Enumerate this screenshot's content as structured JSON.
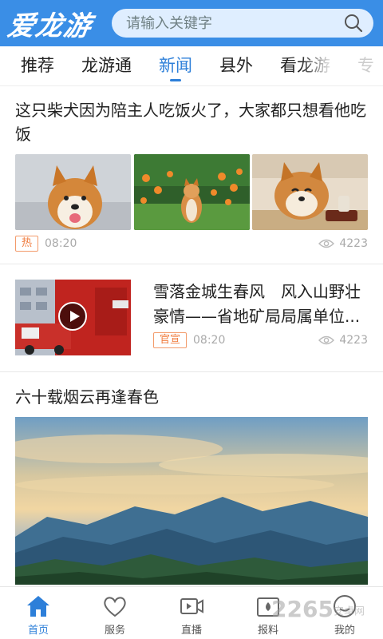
{
  "header": {
    "logo": "爱龙游",
    "search_placeholder": "请输入关键字",
    "search_icon": "search-icon"
  },
  "tabs": [
    {
      "label": "推荐"
    },
    {
      "label": "龙游通"
    },
    {
      "label": "新闻",
      "active": true
    },
    {
      "label": "县外"
    },
    {
      "label": "看龙游"
    },
    {
      "label": "专"
    }
  ],
  "articles": [
    {
      "title": "这只柴犬因为陪主人吃饭火了，大家都只想看他吃饭",
      "tag": "热",
      "time": "08:20",
      "views": "4223"
    },
    {
      "title": "雪落金城生春风　风入山野壮豪情——省地矿局局属单位...",
      "tag": "官宣",
      "time": "08:20",
      "views": "4223"
    },
    {
      "title": "六十载烟云再逢春色"
    }
  ],
  "bottom_nav": [
    {
      "label": "首页",
      "icon": "home-icon",
      "active": true
    },
    {
      "label": "服务",
      "icon": "heart-icon"
    },
    {
      "label": "直播",
      "icon": "video-camera-icon"
    },
    {
      "label": "报料",
      "icon": "camera-icon"
    },
    {
      "label": "我的",
      "icon": "user-icon"
    }
  ],
  "watermark": {
    "brand": "2265",
    "suffix": "安卓网"
  },
  "colors": {
    "primary": "#3a8ee6",
    "accent": "#2d7fd9",
    "tag": "#f07a3b"
  }
}
